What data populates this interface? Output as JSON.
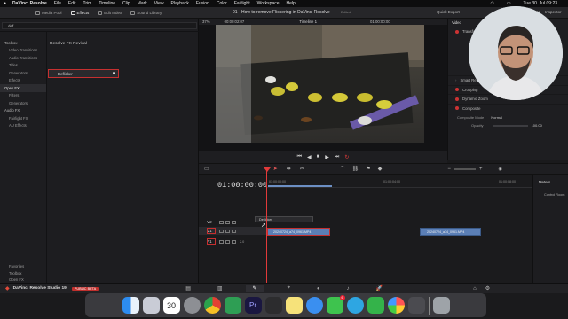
{
  "menubar": {
    "app": "DaVinci Resolve",
    "items": [
      "File",
      "Edit",
      "Trim",
      "Timeline",
      "Clip",
      "Mark",
      "View",
      "Playback",
      "Fusion",
      "Color",
      "Fairlight",
      "Workspace",
      "Help"
    ],
    "clock": "Tue 30. Jul 09:23"
  },
  "toolbar": {
    "buttons": [
      "Media Pool",
      "Effects",
      "Edit Index",
      "Sound Library"
    ],
    "active": "Effects",
    "zoom": "37%",
    "timecode_left": "00:00:02:07",
    "timeline_name": "Timeline 1",
    "project_title": "01 - How to remove Flickering in DaVinci Resolve",
    "edited": "Edited",
    "timecode_right": "01:00:00:00",
    "quick_export": "Quick Export",
    "mixer": "Mixer",
    "metadata": "Metadata",
    "inspector": "Inspector"
  },
  "effects": {
    "search": "def",
    "tree": [
      {
        "label": "Toolbox",
        "group": true
      },
      {
        "label": "Video Transitions",
        "group": false
      },
      {
        "label": "Audio Transitions",
        "group": false
      },
      {
        "label": "Titles",
        "group": false
      },
      {
        "label": "Generators",
        "group": false
      },
      {
        "label": "Effects",
        "group": false
      },
      {
        "label": "Open FX",
        "group": true,
        "selected": true
      },
      {
        "label": "Filters",
        "group": false
      },
      {
        "label": "Generators",
        "group": false
      },
      {
        "label": "Audio FX",
        "group": true
      },
      {
        "label": "Fairlight FX",
        "group": false
      },
      {
        "label": "AU Effects",
        "group": false
      }
    ],
    "tree_bottom": [
      {
        "label": "Favorites"
      },
      {
        "label": "Toolbox"
      },
      {
        "label": "Open FX"
      }
    ],
    "section_title": "Resolve FX Revival",
    "item": "Deflicker"
  },
  "inspector": {
    "tab": "Video",
    "clip_name": "20240724",
    "rows": [
      {
        "label": "Transform",
        "type": "header"
      },
      {
        "label": "Smart Reframe",
        "type": "header"
      },
      {
        "label": "Cropping",
        "type": "header"
      },
      {
        "label": "Dynamic Zoom",
        "type": "header"
      },
      {
        "label": "Composite",
        "type": "header"
      }
    ],
    "composite_mode_label": "Composite Mode",
    "composite_mode_value": "Normal",
    "opacity_label": "Opacity",
    "opacity_value": "100.00"
  },
  "timeline": {
    "timecode": "01:00:00:00",
    "ruler_labels": [
      "01:00:00:00",
      "01:00:04:00",
      "01:00:08:00"
    ],
    "tracks": [
      {
        "name": "V2",
        "type": "video"
      },
      {
        "name": "V1",
        "type": "video"
      },
      {
        "name": "A1",
        "type": "audio",
        "level": "2.0"
      }
    ],
    "clip_1": "20240724_a74_0961.MP4",
    "clip_2": "20240724_a74_0961.MP4",
    "drag_tooltip": "Deflicker",
    "meters_title": "Meters",
    "control_room": "Control Room"
  },
  "pagebar": {
    "product": "DaVinci Resolve Studio 19",
    "badge": "PUBLIC BETA"
  },
  "dock": {
    "calendar_day": "30",
    "mail_badge": "6",
    "apps": [
      "finder",
      "launchpad",
      "calendar",
      "system-settings",
      "chrome",
      "davinci-resolve-tool",
      "premiere",
      "davinci-resolve",
      "notes",
      "safari",
      "messages",
      "telegram",
      "facetime",
      "photos",
      "preview",
      "trash"
    ]
  },
  "colors": {
    "accent_red": "#c63030",
    "clip_blue": "#5b7fb6",
    "playhead": "#e23a3a"
  }
}
